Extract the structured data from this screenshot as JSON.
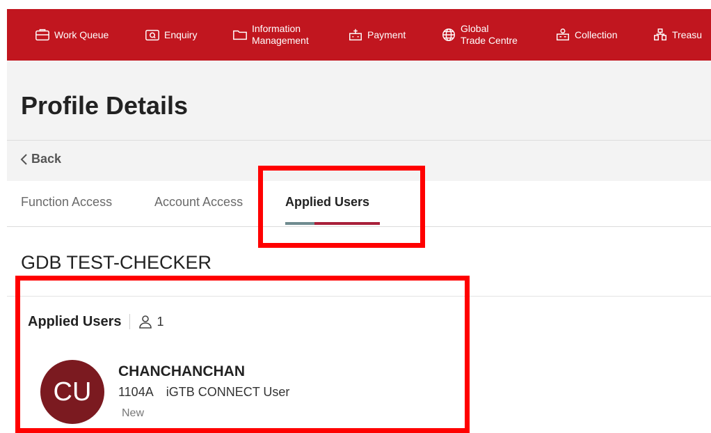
{
  "colors": {
    "brand": "#c1161f",
    "avatar": "#7b1a20",
    "highlight": "#ff0000",
    "tab_accent": "#a8203a",
    "tab_accent_muted": "#6f8b8f"
  },
  "nav": {
    "items": [
      {
        "icon": "briefcase-icon",
        "label": "Work Queue"
      },
      {
        "icon": "enquiry-icon",
        "label": "Enquiry"
      },
      {
        "icon": "folder-icon",
        "label_line1": "Information",
        "label_line2": "Management"
      },
      {
        "icon": "payment-icon",
        "label": "Payment"
      },
      {
        "icon": "globe-icon",
        "label_line1": "Global",
        "label_line2": "Trade Centre"
      },
      {
        "icon": "collection-icon",
        "label": "Collection"
      },
      {
        "icon": "treasury-icon",
        "label": "Treasu"
      }
    ]
  },
  "page": {
    "title": "Profile Details",
    "back_label": "Back"
  },
  "tabs": [
    {
      "label": "Function Access",
      "active": false
    },
    {
      "label": "Account Access",
      "active": false
    },
    {
      "label": "Applied Users",
      "active": true
    }
  ],
  "role": {
    "name": "GDB TEST-CHECKER"
  },
  "applied_users": {
    "title": "Applied Users",
    "count": "1",
    "users": [
      {
        "initials": "CU",
        "name": "CHANCHANCHAN",
        "id": "1104A",
        "type": "iGTB CONNECT User",
        "status": "New"
      }
    ]
  }
}
